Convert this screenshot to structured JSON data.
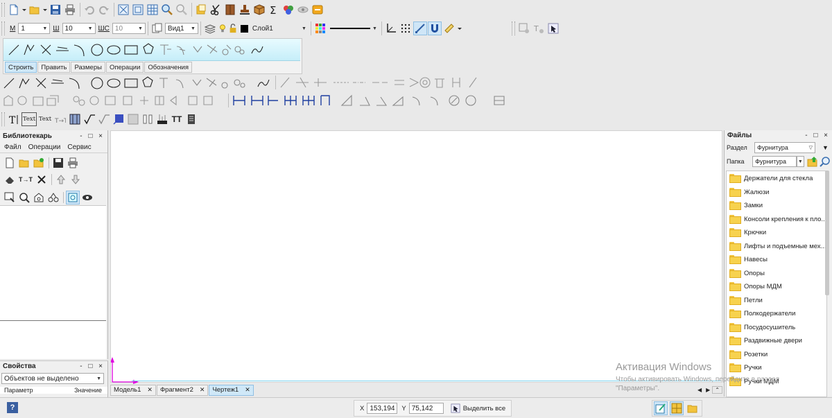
{
  "toolbar_row2": {
    "m_label": "М",
    "m_value": "1",
    "w_label": "Ш",
    "w_value": "10",
    "ws_label": "ШС",
    "ws_value": "10",
    "view_value": "Вид1",
    "layer_value": "Слой1"
  },
  "compact_panel": {
    "tabs": [
      "Строить",
      "Править",
      "Размеры",
      "Операции",
      "Обозначения"
    ]
  },
  "text_toolbar": {
    "text_btn_1": "Text",
    "text_btn_2": "Text",
    "tt_btn": "TT"
  },
  "librarian": {
    "title": "Библиотекарь",
    "controls": "- □ ×",
    "menu": [
      "Файл",
      "Операции",
      "Сервис"
    ],
    "tools_row2_label": "T→T"
  },
  "properties": {
    "title": "Свойства",
    "controls": "- □ ×",
    "selection_value": "Объектов не выделено",
    "col_param": "Параметр",
    "col_value": "Значение"
  },
  "files_panel": {
    "title": "Файлы",
    "controls": "- □ ×",
    "section_label": "Раздел",
    "section_value": "Фурнитура",
    "folder_label": "Папка",
    "folder_value": "Фурнитура",
    "items": [
      "Держатели для стекла",
      "Жалюзи",
      "Замки",
      "Консоли крепления к пло...",
      "Крючки",
      "Лифты и подъемные мех...",
      "Навесы",
      "Опоры",
      "Опоры МДМ",
      "Петли",
      "Полкодержатели",
      "Посудосушитель",
      "Раздвижные двери",
      "Розетки",
      "Ручки",
      "Ручки МДМ"
    ]
  },
  "doc_tabs": [
    {
      "label": "Модель1",
      "active": false
    },
    {
      "label": "Фрагмент2",
      "active": false
    },
    {
      "label": "Чертеж1",
      "active": true
    }
  ],
  "statusbar": {
    "help": "?",
    "x_label": "X",
    "x_value": "153,194",
    "y_label": "Y",
    "y_value": "75,142",
    "select_all": "Выделить все"
  },
  "watermark": {
    "line1": "Активация Windows",
    "line2": "Чтобы активировать Windows, перейдите в раздел",
    "line3": "\"Параметры\"."
  },
  "colors": {
    "accent": "#cfe8f8",
    "canvas": "#ffffff",
    "axis": "#e000e0",
    "folder": "#f7d24e"
  }
}
